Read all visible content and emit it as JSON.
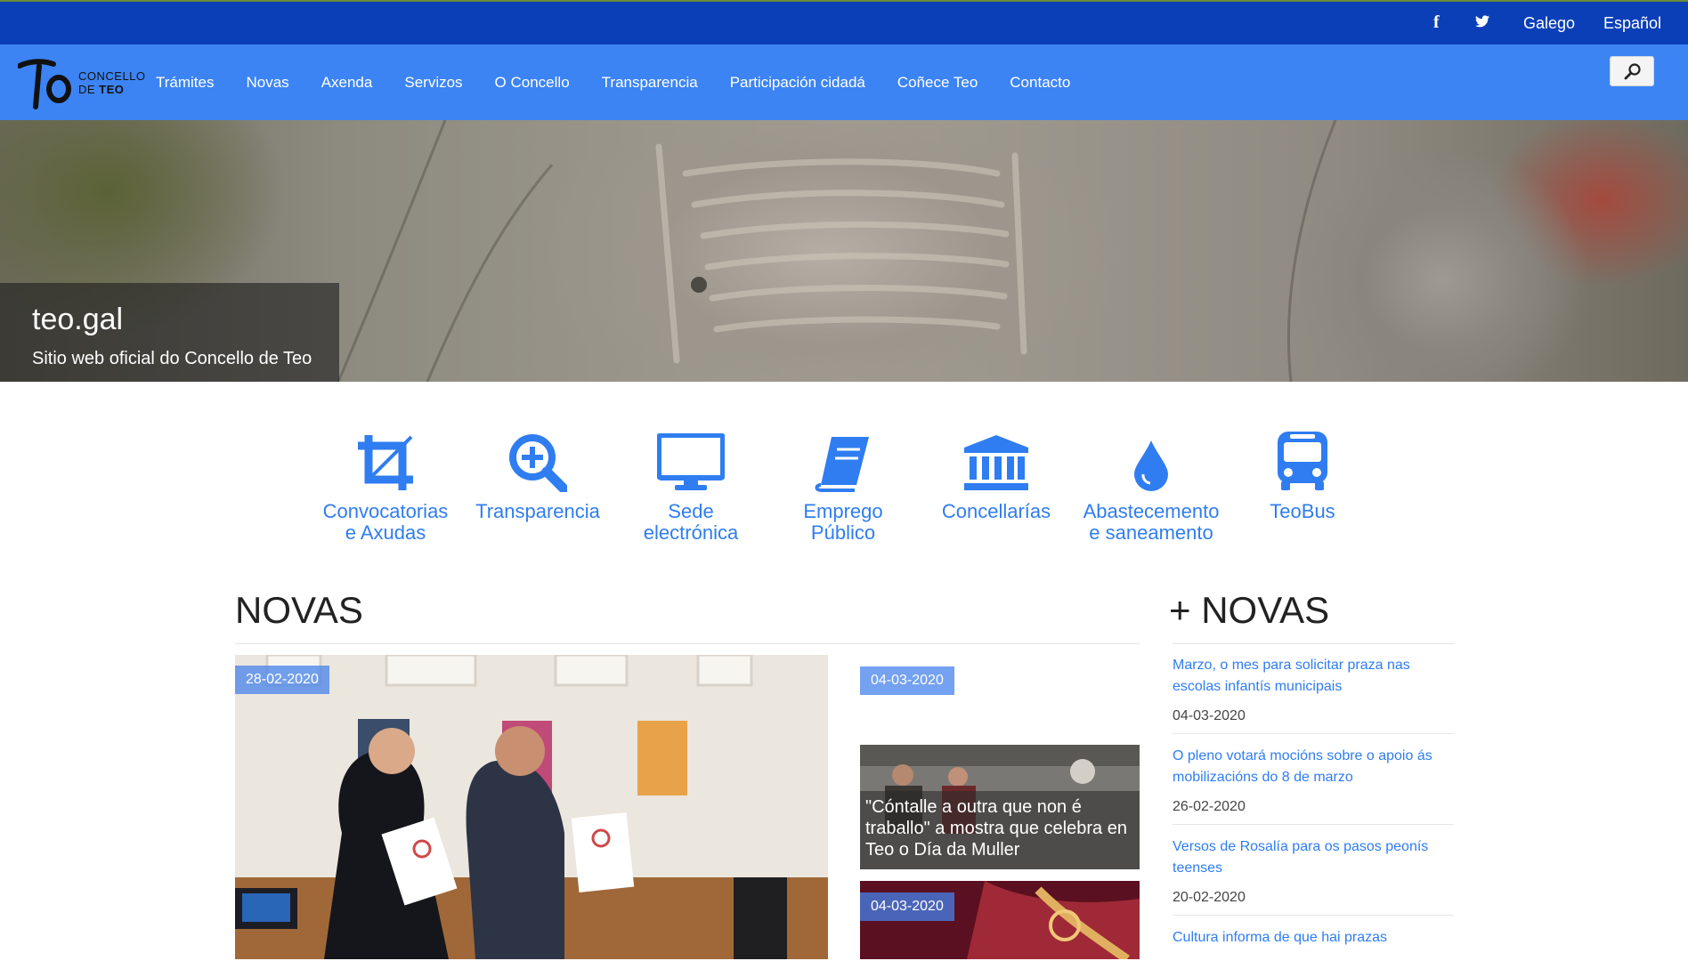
{
  "topbar": {
    "facebook_icon": "f",
    "twitter_icon": "twitter-bird",
    "lang_gl": "Galego",
    "lang_es": "Español"
  },
  "logo": {
    "line1": "CONCELLO",
    "line2a": "DE ",
    "line2b": "TEO"
  },
  "nav": {
    "items": [
      "Trámites",
      "Novas",
      "Axenda",
      "Servizos",
      "O Concello",
      "Transparencia",
      "Participación cidadá",
      "Coñece Teo",
      "Contacto"
    ],
    "search_icon": "search-icon"
  },
  "hero": {
    "title": "teo.gal",
    "subtitle": "Sitio web oficial do Concello de Teo"
  },
  "quick_links": [
    {
      "icon": "crop-icon",
      "label1": "Convocatorias",
      "label2": "e Axudas"
    },
    {
      "icon": "zoom-plus-icon",
      "label1": "Transparencia",
      "label2": ""
    },
    {
      "icon": "monitor-icon",
      "label1": "Sede",
      "label2": "electrónica"
    },
    {
      "icon": "book-icon",
      "label1": "Emprego",
      "label2": "Público"
    },
    {
      "icon": "institution-icon",
      "label1": "Concellarías",
      "label2": ""
    },
    {
      "icon": "drop-icon",
      "label1": "Abastecemento",
      "label2": "e saneamento"
    },
    {
      "icon": "bus-icon",
      "label1": "TeoBus",
      "label2": ""
    }
  ],
  "news": {
    "heading": "NOVAS",
    "main_date": "28-02-2020",
    "side": [
      {
        "date": "04-03-2020",
        "caption": ""
      },
      {
        "date": "",
        "caption": "\"Cóntalle a outra que non é traballo\" a mostra que celebra en Teo o Día da Muller"
      },
      {
        "date": "04-03-2020",
        "caption": ""
      }
    ]
  },
  "more_news": {
    "heading": "+ NOVAS",
    "items": [
      {
        "title": "Marzo, o mes para solicitar praza nas escolas infantís municipais",
        "date": "04-03-2020"
      },
      {
        "title": "O pleno votará mocións sobre o apoio ás mobilizacións do 8 de marzo",
        "date": "26-02-2020"
      },
      {
        "title": "Versos de Rosalía para os pasos peonís teenses",
        "date": "20-02-2020"
      },
      {
        "title": "Cultura informa de que hai prazas",
        "date": ""
      }
    ]
  },
  "colors": {
    "topbar": "#0b3fb8",
    "navbar": "#3c84f4",
    "accent": "#2f7df0"
  }
}
